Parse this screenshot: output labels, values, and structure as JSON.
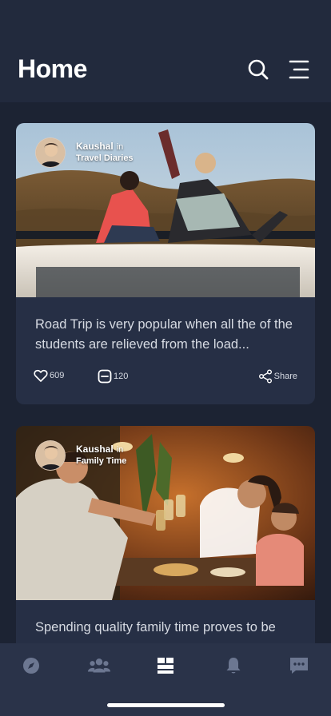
{
  "header": {
    "title": "Home",
    "search_icon": "search-icon",
    "menu_icon": "menu-icon"
  },
  "posts": [
    {
      "author": "Kaushal",
      "connector": "in",
      "group": "Travel Diaries",
      "caption": "Road Trip is very popular when all the of the students are relieved from the load...",
      "likes": "609",
      "comments": "120",
      "share_label": "Share"
    },
    {
      "author": "Kaushal",
      "connector": "in",
      "group": "Family Time",
      "caption": "Spending quality family time proves to be"
    }
  ],
  "tabbar": {
    "items": [
      "compass-icon",
      "users-icon",
      "feed-icon",
      "bell-icon",
      "chat-icon"
    ],
    "active_index": 2,
    "active_color": "#ffffff",
    "inactive_color": "#6c7791"
  },
  "colors": {
    "background": "#1c2333",
    "card": "#262f45",
    "header": "#222a3d",
    "tabbar": "#2a3349"
  }
}
